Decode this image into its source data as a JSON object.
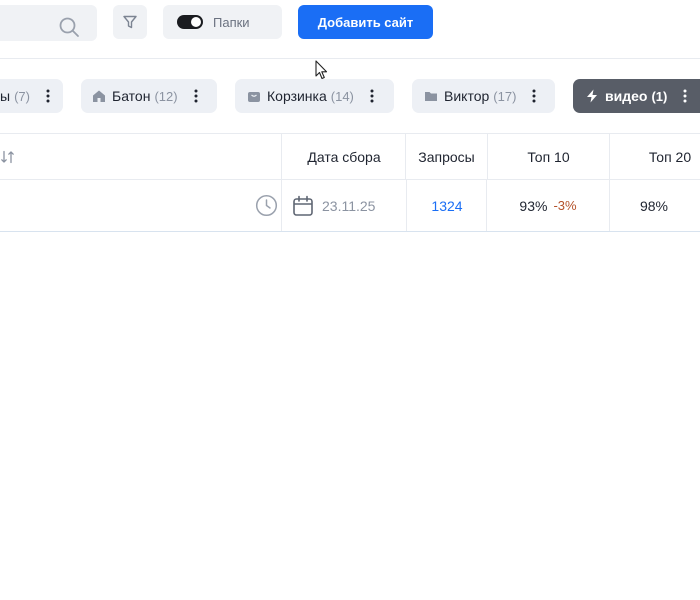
{
  "toolbar": {
    "search_value": "",
    "folders_toggle_label": "Папки",
    "add_site_label": "Добавить сайт"
  },
  "tabs": [
    {
      "name": "ы",
      "count": "(7)",
      "icon": "none"
    },
    {
      "name": "Батон",
      "count": "(12)",
      "icon": "home-icon"
    },
    {
      "name": "Корзинка",
      "count": "(14)",
      "icon": "shopping-bag-icon"
    },
    {
      "name": "Виктор",
      "count": "(17)",
      "icon": "folder-icon"
    },
    {
      "name": "видео",
      "count": "(1)",
      "icon": "lightning-icon",
      "active": true
    }
  ],
  "table": {
    "headers": {
      "date": "Дата сбора",
      "requests": "Запросы",
      "top10": "Топ 10",
      "top20": "Топ 20"
    },
    "rows": [
      {
        "date": "23.11.25",
        "requests": "1324",
        "top10": "93%",
        "top10_delta": "-3%",
        "top20": "98%"
      }
    ]
  },
  "colors": {
    "accent": "#1a6ef5",
    "active_tab": "#585d67",
    "negative_delta": "#b4522a"
  }
}
